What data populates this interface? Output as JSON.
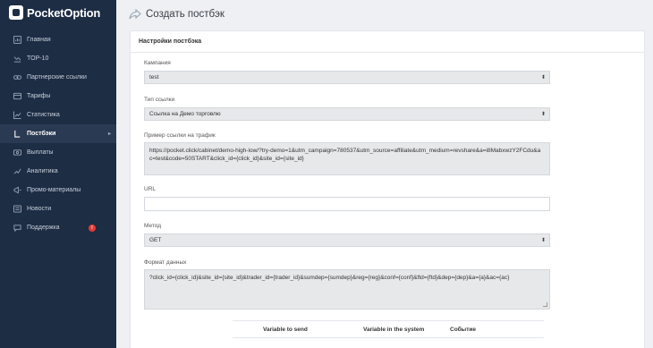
{
  "brand": {
    "name": "PocketOption"
  },
  "sidebar": {
    "items": [
      {
        "label": "Главная",
        "icon": "dashboard-icon"
      },
      {
        "label": "TOP-10",
        "icon": "trophy-icon"
      },
      {
        "label": "Партнерские ссылки",
        "icon": "link-icon"
      },
      {
        "label": "Тарифы",
        "icon": "tariff-icon"
      },
      {
        "label": "Статистика",
        "icon": "chart-icon"
      },
      {
        "label": "Постбэки",
        "icon": "postback-icon",
        "active": true
      },
      {
        "label": "Выплаты",
        "icon": "payout-icon"
      },
      {
        "label": "Аналитика",
        "icon": "analytics-icon"
      },
      {
        "label": "Промо-материалы",
        "icon": "promo-icon"
      },
      {
        "label": "Новости",
        "icon": "news-icon"
      },
      {
        "label": "Поддержка",
        "icon": "support-icon",
        "badge": "!"
      }
    ]
  },
  "header": {
    "title": "Создать постбэк"
  },
  "card": {
    "title": "Настройки постбэка",
    "campaign": {
      "label": "Кампания",
      "value": "test"
    },
    "link_type": {
      "label": "Тип ссылки",
      "value": "Ссылка на Демо торговлю"
    },
    "example": {
      "label": "Пример ссылки на трафик",
      "value": "https://pocket.click/cabinet/demo-high-low/?try-demo=1&utm_campaign=780537&utm_source=affiliate&utm_medium=revshare&a=i8MabxwzY2FCdu&ac=test&code=50START&click_id={click_id}&site_id={site_id}"
    },
    "url": {
      "label": "URL",
      "value": ""
    },
    "method": {
      "label": "Метод",
      "value": "GET"
    },
    "format": {
      "label": "Формат данных",
      "value": "?click_id={click_id}&site_id={site_id}&trader_id={trader_id}&sumdep={sumdep}&reg={reg}&conf={conf}&ftd={ftd}&dep={dep}&a={a}&ac={ac}"
    },
    "table": {
      "columns": [
        "Variable to send",
        "Variable in the system",
        "Событие"
      ]
    }
  },
  "colors": {
    "sidebar_bg": "#1d2d44",
    "active_bg": "#2a3a52",
    "badge": "#e53935"
  }
}
